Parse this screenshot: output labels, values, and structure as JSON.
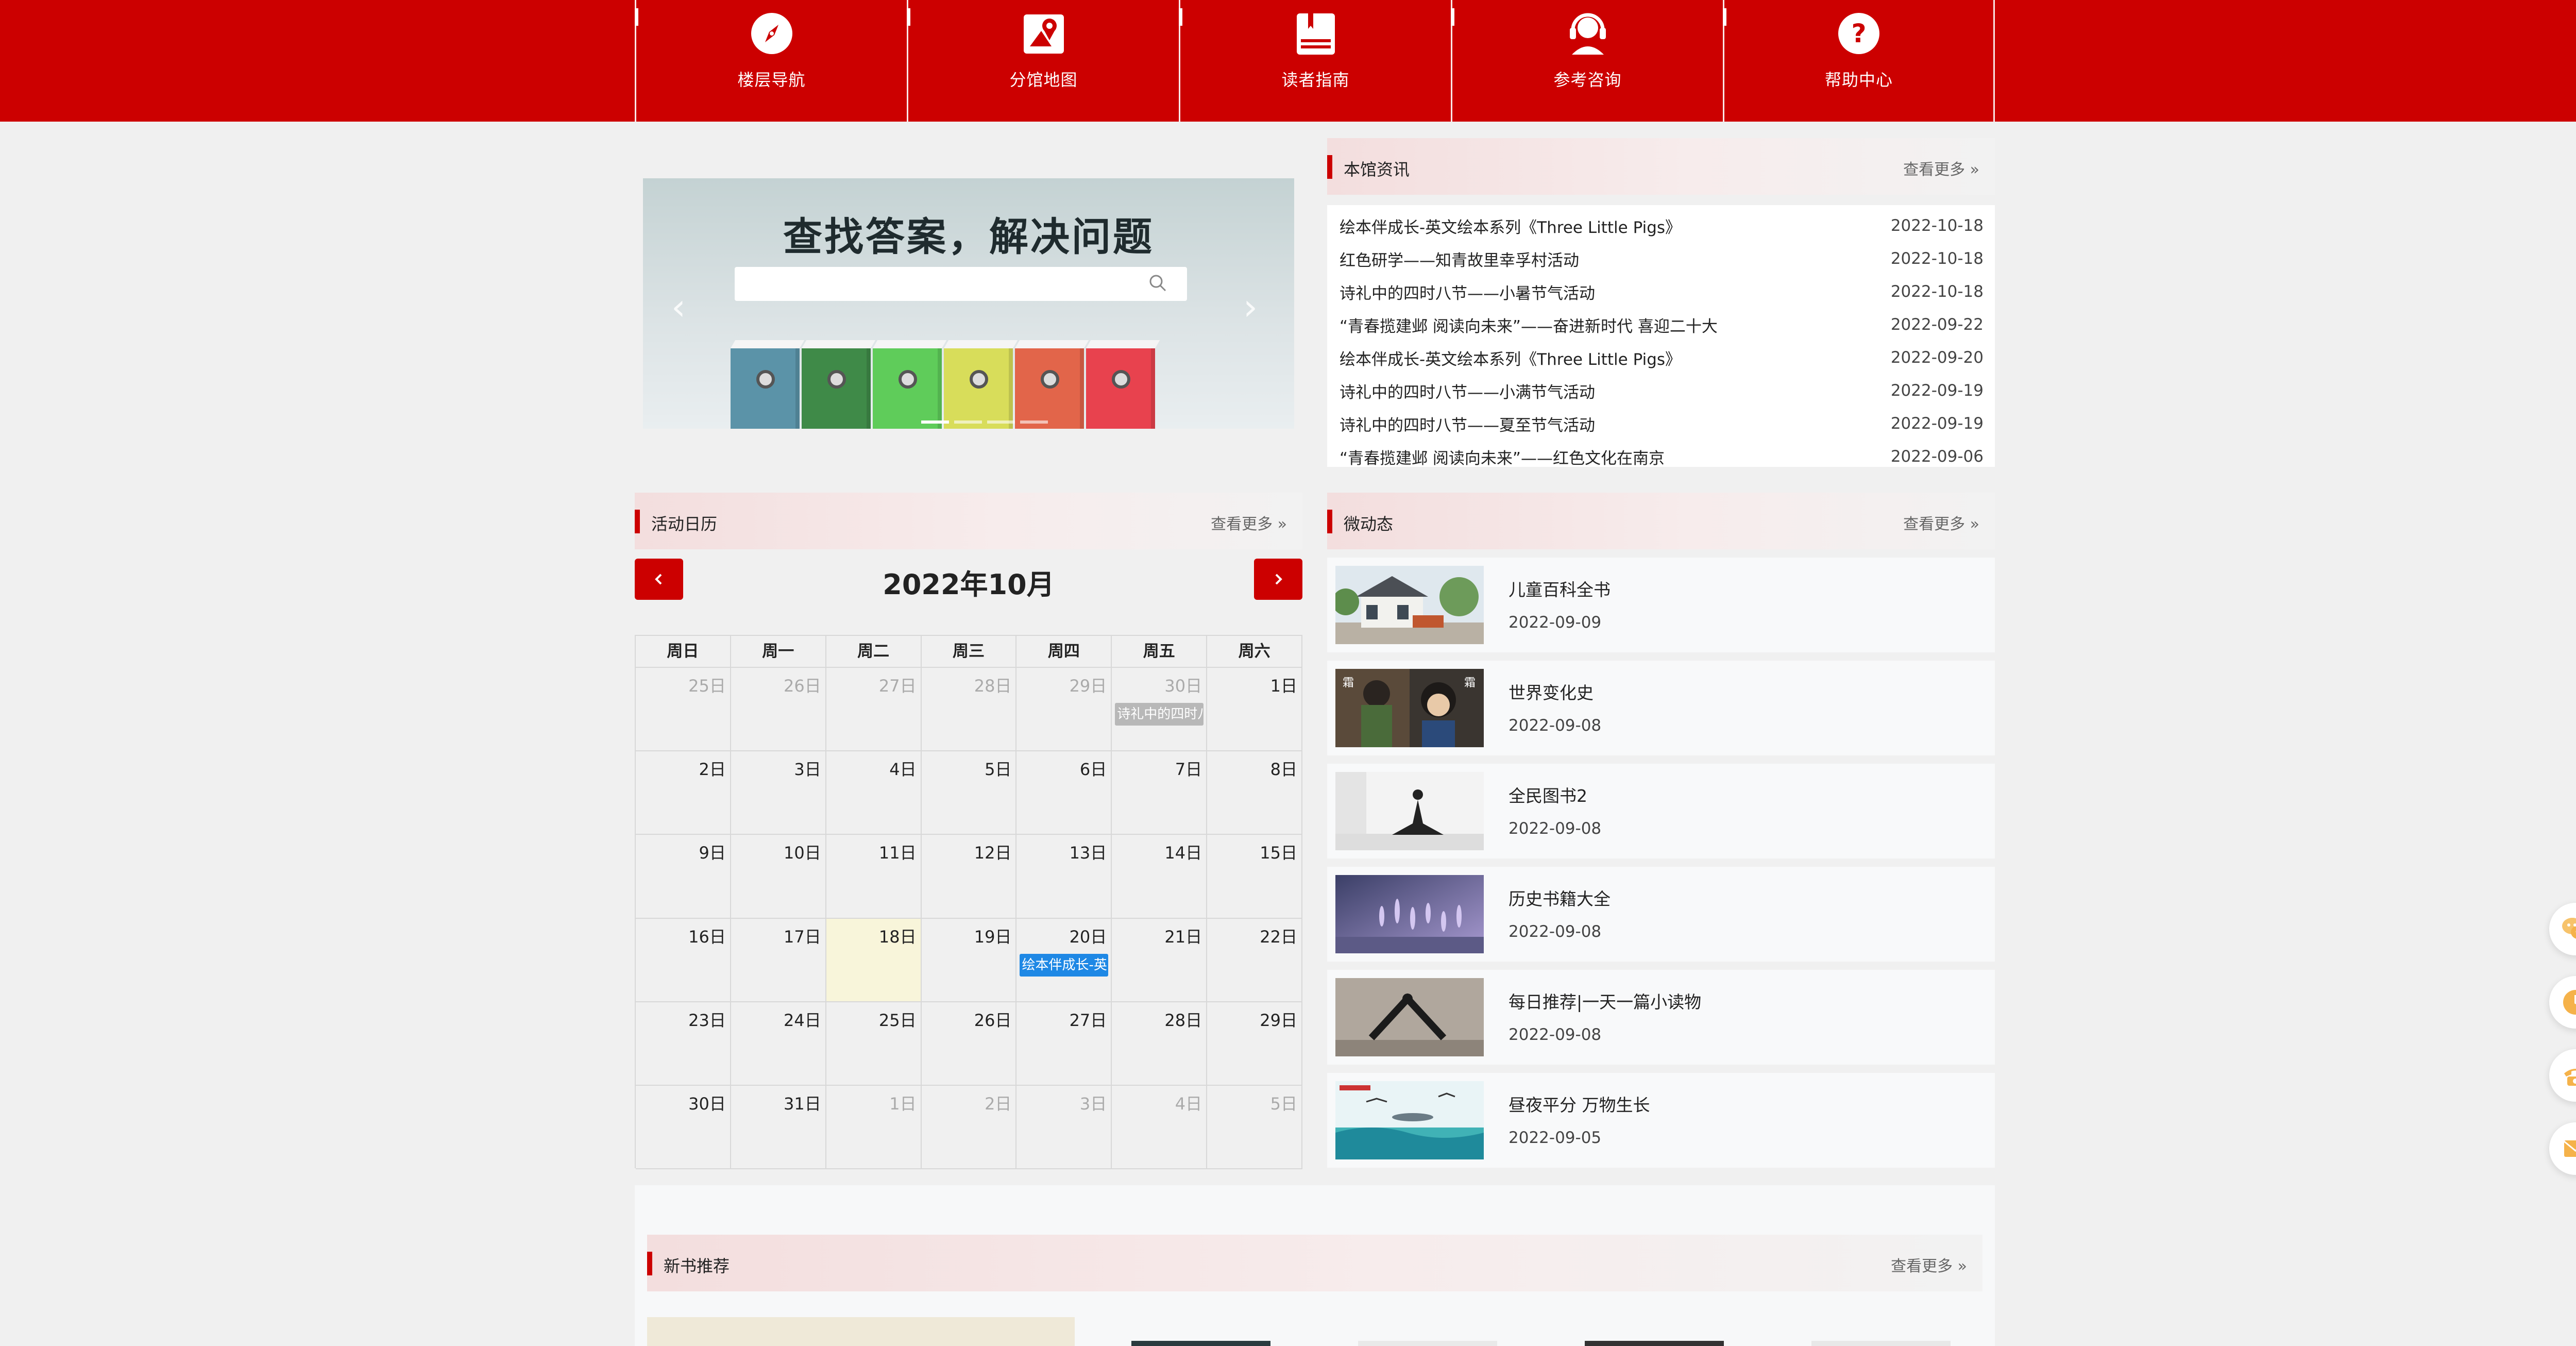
{
  "nav": {
    "items": [
      {
        "label": "楼层导航",
        "icon": "compass-icon"
      },
      {
        "label": "分馆地图",
        "icon": "map-pin-icon"
      },
      {
        "label": "读者指南",
        "icon": "book-icon"
      },
      {
        "label": "参考咨询",
        "icon": "headset-icon"
      },
      {
        "label": "帮助中心",
        "icon": "question-icon"
      }
    ]
  },
  "banner": {
    "headline": "查找答案，解决问题",
    "search_placeholder": "",
    "binder_colors": [
      "#5b93a8",
      "#3f8a48",
      "#5fcc5a",
      "#d8dd5a",
      "#e2654a",
      "#e8424e"
    ]
  },
  "news": {
    "title": "本馆资讯",
    "more": "查看更多",
    "items": [
      {
        "title": "绘本伴成长-英文绘本系列《Three Little Pigs》",
        "date": "2022-10-18"
      },
      {
        "title": "红色研学——知青故里幸孚村活动",
        "date": "2022-10-18"
      },
      {
        "title": "诗礼中的四时八节——小暑节气活动",
        "date": "2022-10-18"
      },
      {
        "title": "“青春揽建邺 阅读向未来”——奋进新时代 喜迎二十大",
        "date": "2022-09-22"
      },
      {
        "title": "绘本伴成长-英文绘本系列《Three Little Pigs》",
        "date": "2022-09-20"
      },
      {
        "title": "诗礼中的四时八节——小满节气活动",
        "date": "2022-09-19"
      },
      {
        "title": "诗礼中的四时八节——夏至节气活动",
        "date": "2022-09-19"
      },
      {
        "title": "“青春揽建邺 阅读向未来”——红色文化在南京",
        "date": "2022-09-06"
      }
    ]
  },
  "calendar": {
    "section_title": "活动日历",
    "more": "查看更多",
    "month_title": "2022年10月",
    "weekdays": [
      "周日",
      "周一",
      "周二",
      "周三",
      "周四",
      "周五",
      "周六"
    ],
    "weeks": [
      [
        {
          "n": "25日",
          "o": true
        },
        {
          "n": "26日",
          "o": true
        },
        {
          "n": "27日",
          "o": true
        },
        {
          "n": "28日",
          "o": true
        },
        {
          "n": "29日",
          "o": true
        },
        {
          "n": "30日",
          "o": true,
          "evt": "诗礼中的四时八节",
          "evt_color": "#b8b8b8"
        },
        {
          "n": "1日"
        }
      ],
      [
        {
          "n": "2日"
        },
        {
          "n": "3日"
        },
        {
          "n": "4日"
        },
        {
          "n": "5日"
        },
        {
          "n": "6日"
        },
        {
          "n": "7日"
        },
        {
          "n": "8日"
        }
      ],
      [
        {
          "n": "9日"
        },
        {
          "n": "10日"
        },
        {
          "n": "11日"
        },
        {
          "n": "12日"
        },
        {
          "n": "13日"
        },
        {
          "n": "14日"
        },
        {
          "n": "15日"
        }
      ],
      [
        {
          "n": "16日"
        },
        {
          "n": "17日"
        },
        {
          "n": "18日",
          "today": true
        },
        {
          "n": "19日"
        },
        {
          "n": "20日",
          "evt": "绘本伴成长-英",
          "evt_color": "#1e88e5"
        },
        {
          "n": "21日"
        },
        {
          "n": "22日"
        }
      ],
      [
        {
          "n": "23日"
        },
        {
          "n": "24日"
        },
        {
          "n": "25日"
        },
        {
          "n": "26日"
        },
        {
          "n": "27日"
        },
        {
          "n": "28日"
        },
        {
          "n": "29日"
        }
      ],
      [
        {
          "n": "30日"
        },
        {
          "n": "31日"
        },
        {
          "n": "1日",
          "o": true
        },
        {
          "n": "2日",
          "o": true
        },
        {
          "n": "3日",
          "o": true
        },
        {
          "n": "4日",
          "o": true
        },
        {
          "n": "5日",
          "o": true
        }
      ]
    ]
  },
  "feed": {
    "title": "微动态",
    "more": "查看更多",
    "items": [
      {
        "title": "儿童百科全书",
        "date": "2022-09-09",
        "thumb": "house"
      },
      {
        "title": "世界变化史",
        "date": "2022-09-08",
        "thumb": "people"
      },
      {
        "title": "全民图书2",
        "date": "2022-09-08",
        "thumb": "yoga"
      },
      {
        "title": "历史书籍大全",
        "date": "2022-09-08",
        "thumb": "lavender"
      },
      {
        "title": "每日推荐|一天一篇小读物",
        "date": "2022-09-08",
        "thumb": "stretch"
      },
      {
        "title": "昼夜平分 万物生长",
        "date": "2022-09-05",
        "thumb": "sea"
      }
    ]
  },
  "newbooks": {
    "title": "新书推荐",
    "more": "查看更多"
  },
  "float_tools": [
    "wechat-icon",
    "clock-icon",
    "phone-icon",
    "mail-icon"
  ],
  "colors": {
    "accent": "#cc0000",
    "today": "#f8f5da"
  }
}
